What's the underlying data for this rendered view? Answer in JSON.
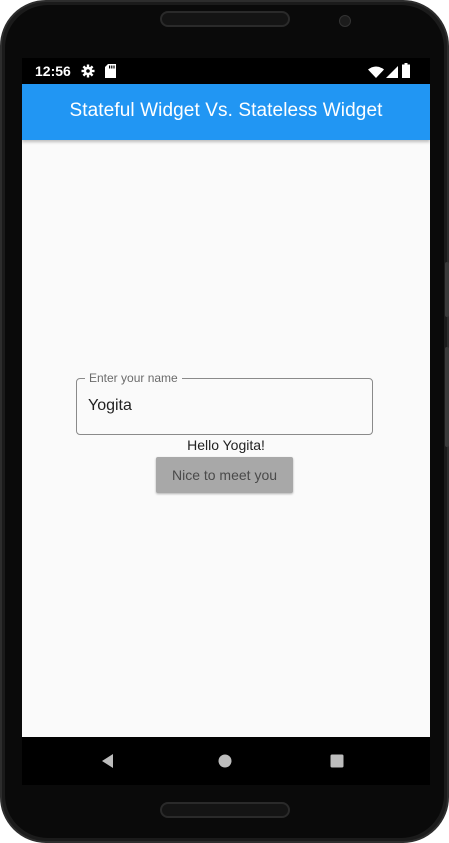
{
  "status_bar": {
    "time": "12:56",
    "icons": [
      "gear-icon",
      "sd-card-icon",
      "wifi-icon",
      "signal-icon",
      "battery-icon"
    ]
  },
  "app_bar": {
    "title": "Stateful Widget Vs. Stateless Widget",
    "color": "#2196f3"
  },
  "form": {
    "name_label": "Enter your name",
    "name_value": "Yogita",
    "greeting": "Hello Yogita!",
    "button_label": "Nice to meet you"
  },
  "nav_bar": {
    "items": [
      "back-icon",
      "home-icon",
      "recents-icon"
    ]
  }
}
